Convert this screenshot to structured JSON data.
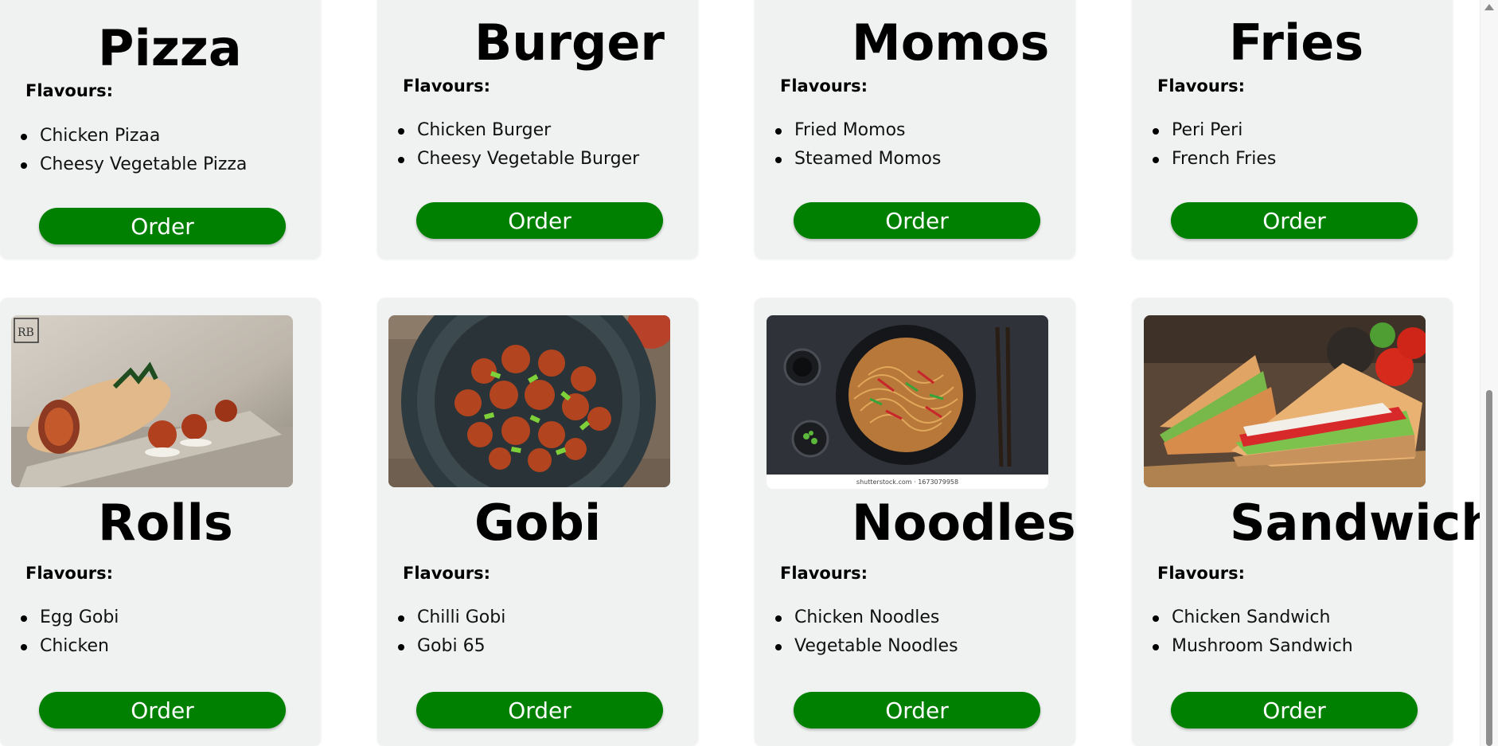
{
  "menu": {
    "flavours_label": "Flavours:",
    "order_label": "Order",
    "cards": [
      {
        "title": "Pizza",
        "flavours": [
          "Chicken Pizaa",
          "Cheesy Vegetable Pizza"
        ]
      },
      {
        "title": "Burger",
        "flavours": [
          "Chicken Burger",
          "Cheesy Vegetable Burger"
        ]
      },
      {
        "title": "Momos",
        "flavours": [
          "Fried Momos",
          "Steamed Momos"
        ]
      },
      {
        "title": "Fries",
        "flavours": [
          "Peri Peri",
          "French Fries"
        ]
      },
      {
        "title": "Rolls",
        "image": "rolls-photo",
        "flavours": [
          "Egg Gobi",
          "Chicken"
        ]
      },
      {
        "title": "Gobi",
        "image": "gobi-photo",
        "flavours": [
          "Chilli Gobi",
          "Gobi 65"
        ]
      },
      {
        "title": "Noodles",
        "image": "noodles-photo",
        "image_caption": "shutterstock.com · 1673079958",
        "flavours": [
          "Chicken Noodles",
          "Vegetable Noodles"
        ]
      },
      {
        "title": "Sandwich",
        "image": "sandwich-photo",
        "flavours": [
          "Chicken Sandwich",
          "Mushroom Sandwich"
        ]
      }
    ]
  },
  "colors": {
    "card_background": "#f0f2f1",
    "order_button": "#008000",
    "order_text": "#ffffff"
  },
  "icons": {
    "scroll_up": "scroll-up-arrow-icon"
  }
}
